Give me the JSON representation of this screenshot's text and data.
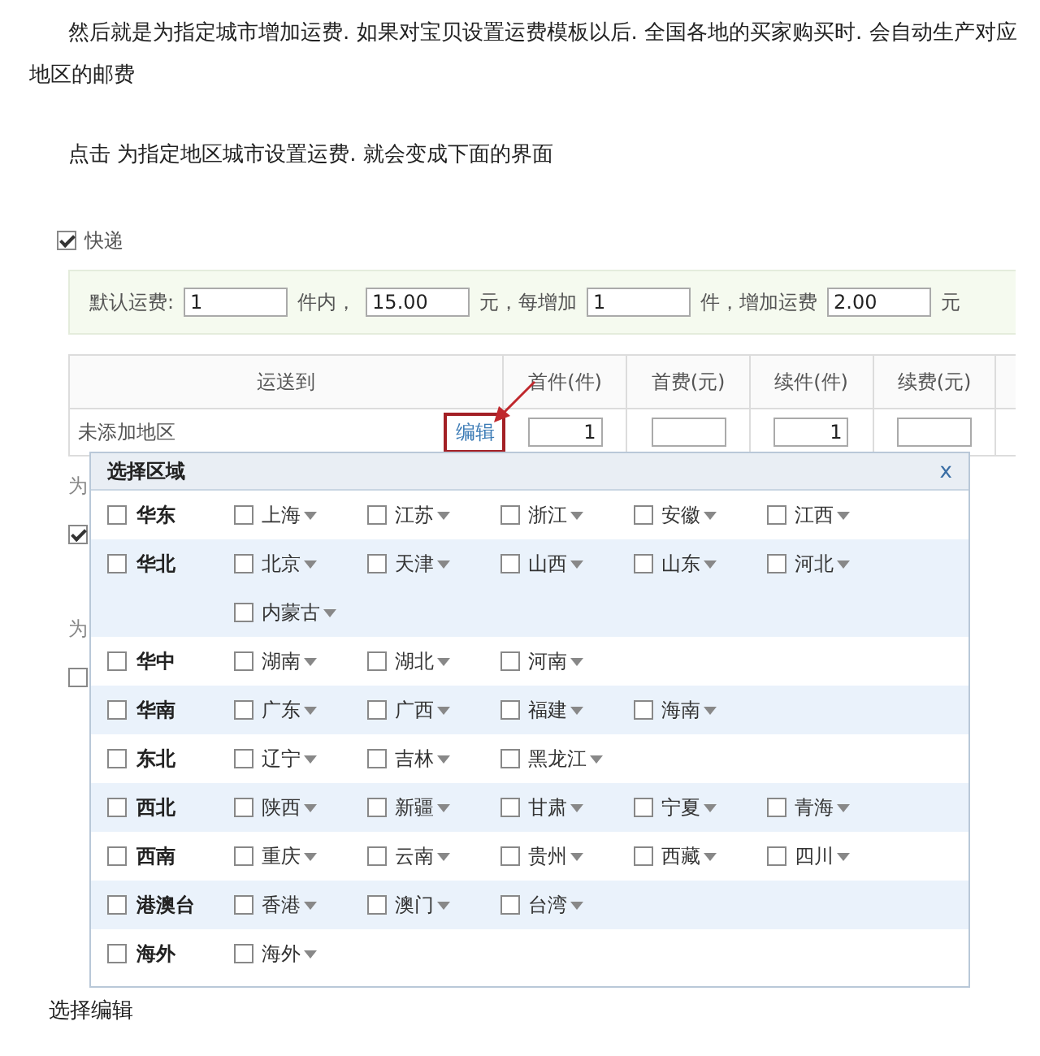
{
  "article": {
    "paragraph_1": "然后就是为指定城市增加运费. 如果对宝贝设置运费模板以后. 全国各地的买家购买时. 会自动生产对应地区的邮费",
    "paragraph_2": "点击  为指定地区城市设置运费. 就会变成下面的界面",
    "caption": "选择编辑"
  },
  "form": {
    "express": {
      "label": "快递",
      "checked": true
    },
    "default_fee": [
      {
        "kind": "label",
        "text": "默认运费:"
      },
      {
        "kind": "input",
        "value": "1"
      },
      {
        "kind": "label",
        "text": "件内，"
      },
      {
        "kind": "input",
        "value": "15.00"
      },
      {
        "kind": "label",
        "text": "元，每增加"
      },
      {
        "kind": "input",
        "value": "1"
      },
      {
        "kind": "label",
        "text": "件，增加运费"
      },
      {
        "kind": "input",
        "value": "2.00"
      },
      {
        "kind": "label",
        "text": "元"
      }
    ],
    "table": {
      "columns": [
        "运送到",
        "首件(件)",
        "首费(元)",
        "续件(件)",
        "续费(元)"
      ],
      "rows": [
        {
          "area": "未添加地区",
          "edit_link": "编辑",
          "highlighted": true,
          "inputs": [
            {
              "kind": "filled",
              "value": "1"
            },
            {
              "kind": "blank"
            },
            {
              "kind": "filled",
              "value": "1"
            },
            {
              "kind": "blank"
            }
          ]
        }
      ]
    },
    "behind_popup": [
      {
        "kind": "text",
        "text": "为"
      },
      {
        "kind": "checkbox",
        "checked": true
      },
      {
        "kind": "text",
        "text": "为"
      },
      {
        "kind": "checkbox",
        "checked": false
      }
    ]
  },
  "popup": {
    "title": "选择区域",
    "close": "x",
    "regions": [
      {
        "name": "华东",
        "checked": false,
        "provinces": [
          {
            "name": "上海",
            "checked": false
          },
          {
            "name": "江苏",
            "checked": false
          },
          {
            "name": "浙江",
            "checked": false
          },
          {
            "name": "安徽",
            "checked": false
          },
          {
            "name": "江西",
            "checked": false
          }
        ]
      },
      {
        "name": "华北",
        "checked": false,
        "provinces": [
          {
            "name": "北京",
            "checked": false
          },
          {
            "name": "天津",
            "checked": false
          },
          {
            "name": "山西",
            "checked": false
          },
          {
            "name": "山东",
            "checked": false
          },
          {
            "name": "河北",
            "checked": false
          },
          {
            "name": "内蒙古",
            "checked": false
          }
        ]
      },
      {
        "name": "华中",
        "checked": false,
        "provinces": [
          {
            "name": "湖南",
            "checked": false
          },
          {
            "name": "湖北",
            "checked": false
          },
          {
            "name": "河南",
            "checked": false
          }
        ]
      },
      {
        "name": "华南",
        "checked": false,
        "provinces": [
          {
            "name": "广东",
            "checked": false
          },
          {
            "name": "广西",
            "checked": false
          },
          {
            "name": "福建",
            "checked": false
          },
          {
            "name": "海南",
            "checked": false
          }
        ]
      },
      {
        "name": "东北",
        "checked": false,
        "provinces": [
          {
            "name": "辽宁",
            "checked": false
          },
          {
            "name": "吉林",
            "checked": false
          },
          {
            "name": "黑龙江",
            "checked": false
          }
        ]
      },
      {
        "name": "西北",
        "checked": false,
        "provinces": [
          {
            "name": "陕西",
            "checked": false
          },
          {
            "name": "新疆",
            "checked": false
          },
          {
            "name": "甘肃",
            "checked": false
          },
          {
            "name": "宁夏",
            "checked": false
          },
          {
            "name": "青海",
            "checked": false
          }
        ]
      },
      {
        "name": "西南",
        "checked": false,
        "provinces": [
          {
            "name": "重庆",
            "checked": false
          },
          {
            "name": "云南",
            "checked": false
          },
          {
            "name": "贵州",
            "checked": false
          },
          {
            "name": "西藏",
            "checked": false
          },
          {
            "name": "四川",
            "checked": false
          }
        ]
      },
      {
        "name": "港澳台",
        "checked": false,
        "provinces": [
          {
            "name": "香港",
            "checked": false
          },
          {
            "name": "澳门",
            "checked": false
          },
          {
            "name": "台湾",
            "checked": false
          }
        ]
      },
      {
        "name": "海外",
        "checked": false,
        "provinces": [
          {
            "name": "海外",
            "checked": false
          }
        ]
      }
    ]
  }
}
